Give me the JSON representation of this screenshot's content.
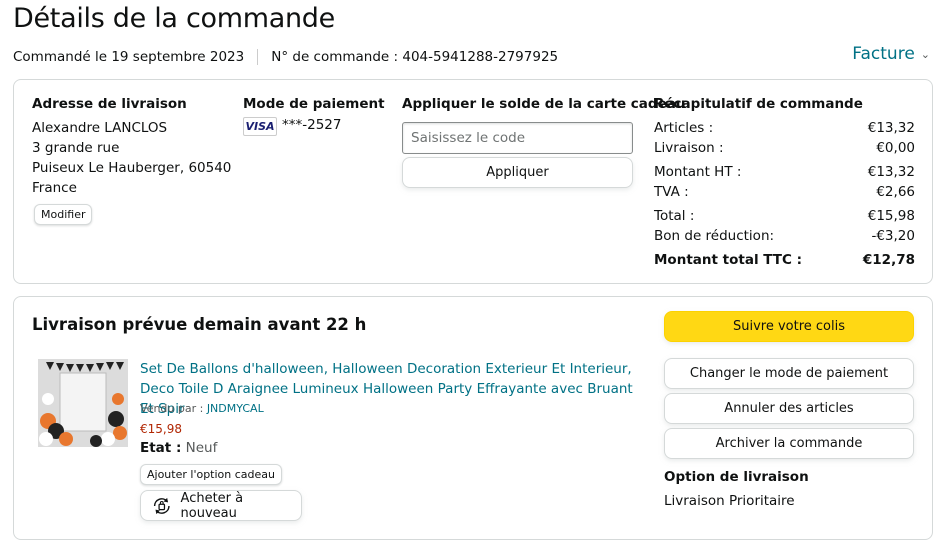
{
  "page": {
    "title": "Détails de la commande",
    "order_date": "Commandé le 19 septembre 2023",
    "order_number": "N° de commande : 404-5941288-2797925",
    "invoice_label": "Facture"
  },
  "shipping": {
    "heading": "Adresse de livraison",
    "name": "Alexandre LANCLOS",
    "street": "3 grande rue",
    "city": "Puiseux Le Hauberger, 60540",
    "country": "France",
    "edit_label": "Modifier"
  },
  "payment": {
    "heading": "Mode de paiement",
    "card_brand": "VISA",
    "card_digits": "***-2527"
  },
  "gift_card": {
    "heading": "Appliquer le solde de la carte cadeau",
    "placeholder": "Saisissez le code",
    "apply_label": "Appliquer"
  },
  "summary": {
    "heading": "Récapitulatif de commande",
    "rows": [
      {
        "label": "Articles :",
        "value": "€13,32"
      },
      {
        "label": "Livraison :",
        "value": "€0,00"
      },
      {
        "label": "Montant HT :",
        "value": "€13,32"
      },
      {
        "label": "TVA :",
        "value": "€2,66"
      },
      {
        "label": "Total :",
        "value": "€15,98"
      },
      {
        "label": "Bon de réduction:",
        "value": "-€3,20"
      }
    ],
    "grand_total_label": "Montant total TTC :",
    "grand_total_value": "€12,78"
  },
  "delivery": {
    "heading": "Livraison prévue demain avant 22 h",
    "product_title": "Set De Ballons d'halloween, Halloween Decoration Exterieur Et Interieur, Deco Toile D Araignee Lumineux Halloween Party Effrayante avec Bruant Et Spir",
    "seller_prefix": "Vendu par :",
    "seller_name": "JNDMYCAL",
    "price": "€15,98",
    "state_label": "Etat :",
    "state_value": "Neuf",
    "gift_option_label": "Ajouter l'option cadeau",
    "rebuy_label": "Acheter à nouveau",
    "track_label": "Suivre votre colis",
    "change_payment_label": "Changer le mode de paiement",
    "cancel_label": "Annuler des articles",
    "archive_label": "Archiver la commande",
    "option_heading": "Option de livraison",
    "option_value": "Livraison Prioritaire"
  }
}
